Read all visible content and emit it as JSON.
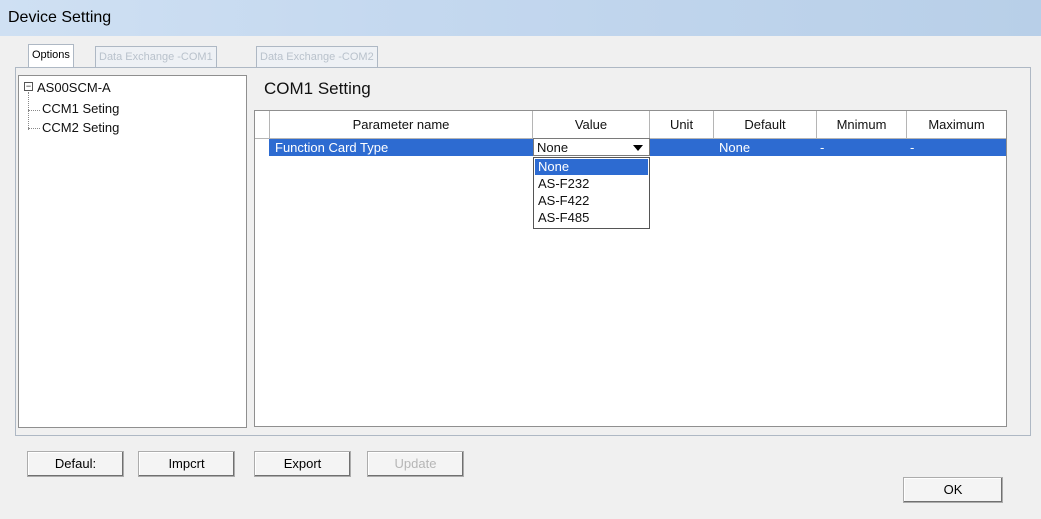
{
  "window": {
    "title": "Device Setting"
  },
  "tabs": [
    {
      "label": "Options",
      "active": true
    },
    {
      "label": "Data Exchange -COM1",
      "active": false
    },
    {
      "label": "Data Exchange -COM2",
      "active": false
    }
  ],
  "tree": {
    "root": "AS00SCM-A",
    "items": [
      "CCM1 Seting",
      "CCM2 Seting"
    ]
  },
  "panel": {
    "title": "COM1 Setting"
  },
  "grid": {
    "columns": [
      "Parameter name",
      "Value",
      "Unit",
      "Default",
      "Mnimum",
      "Maximum"
    ],
    "row": {
      "parameter": "Function Card Type",
      "value": "None",
      "unit": "",
      "default": "None",
      "minimum": "-",
      "maximum": "-"
    }
  },
  "dropdown": {
    "options": [
      "None",
      "AS-F232",
      "AS-F422",
      "AS-F485"
    ],
    "selected": "None"
  },
  "buttons": {
    "default": "Defaul:",
    "import": "Impcrt",
    "export": "Export",
    "update": "Update",
    "ok": "OK"
  },
  "colors": {
    "selection": "#2d6bd1",
    "titlebar": "#c4d8ef"
  }
}
